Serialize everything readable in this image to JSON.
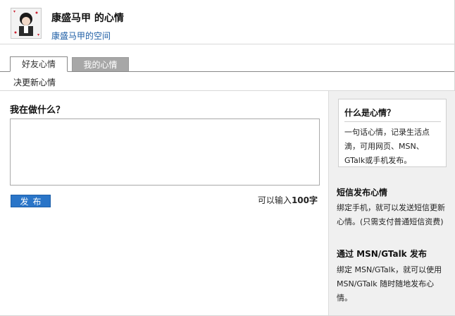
{
  "header": {
    "title": "康盛马甲 的心情",
    "space_link": "康盛马甲的空间"
  },
  "tabs": [
    {
      "label": "好友心情",
      "active": true
    },
    {
      "label": "我的心情",
      "active": false
    }
  ],
  "subtitle": "决更新心情",
  "form": {
    "question": "我在做什么？",
    "input_value": "",
    "publish_label": "发布",
    "limit_prefix": "可以输入",
    "limit_count": "100字"
  },
  "sidebar": {
    "what_title": "什么是心情？",
    "what_text": "一句话心情，记录生活点滴，可用网页、MSN、GTalk或手机发布。",
    "sms_title": "短信发布心情",
    "sms_text": "绑定手机，就可以发送短信更新心情。(只需支付普通短信资费)",
    "msn_title": "通过 MSN/GTalk 发布",
    "msn_text": "绑定 MSN/GTalk，就可以使用 MSN/GTalk 随时随地发布心情。"
  },
  "colors": {
    "link": "#1f5fa6",
    "button": "#2a75c8",
    "inactive_tab": "#a7a7a7",
    "sidebar_bg": "#f0f0f0"
  }
}
